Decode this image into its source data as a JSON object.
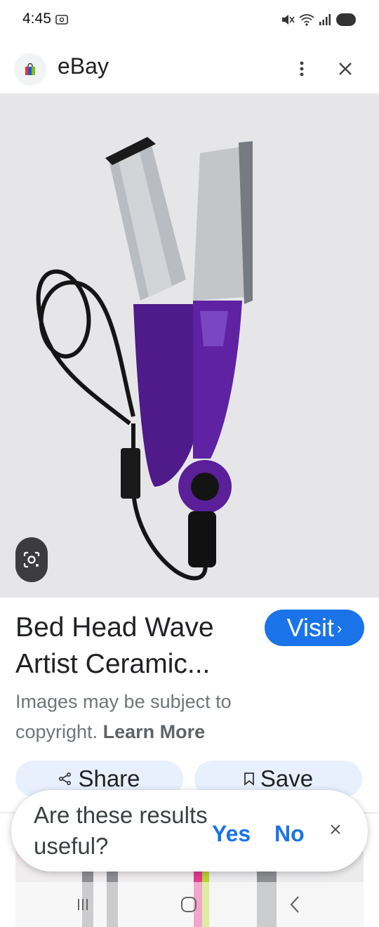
{
  "status_bar": {
    "time": "4:45"
  },
  "header": {
    "site_name": "eBay",
    "favicon": "shopping-bag-icon",
    "menu_icon": "more-vert-icon",
    "close_icon": "close-icon"
  },
  "product": {
    "image_alt": "product-photo",
    "title": "Bed Head Wave Artist Ceramic...",
    "visit_label": "Visit",
    "copyright_text": "Images may be subject to copyright.",
    "learn_more": "Learn More",
    "share_label": "Share",
    "save_label": "Save"
  },
  "feedback": {
    "question": "Are these results useful?",
    "yes": "Yes",
    "no": "No"
  },
  "colors": {
    "accent": "#1a73e8",
    "pill_bg": "#e8f0fe",
    "product_purple": "#5b1f9a"
  }
}
